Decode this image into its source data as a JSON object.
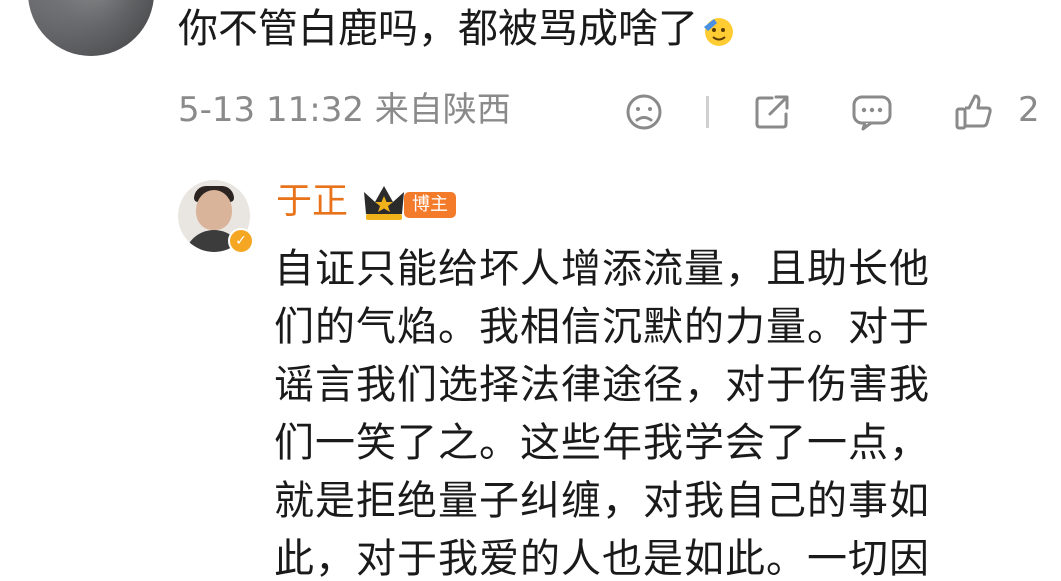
{
  "top_comment": {
    "text": "你不管白鹿吗，都被骂成啥了",
    "emoji": "salute-face-emoji"
  },
  "meta": {
    "timestamp_location": "5-13 11:32 来自陕西",
    "icons": [
      "dislike-face-icon",
      "share-icon",
      "comment-icon",
      "like-thumb-icon"
    ],
    "like_count": "2"
  },
  "reply": {
    "author": "于正",
    "crown_icon": "crown-icon",
    "verified_icon": "verified-v-icon",
    "badge": "博主",
    "lines": [
      "自证只能给坏人增添流量，且助长他",
      "们的气焰。我相信沉默的力量。对于",
      "谣言我们选择法律途径，对于伤害我",
      "们一笑了之。这些年我学会了一点，",
      "就是拒绝量子纠缠，对我自己的事如",
      "此，对于我爱的人也是如此。一切因"
    ]
  },
  "colors": {
    "name_orange": "#e8731a",
    "badge_orange": "#f47b2a",
    "meta_gray": "#8a8a8a",
    "text_dark": "#1a1a1a"
  }
}
